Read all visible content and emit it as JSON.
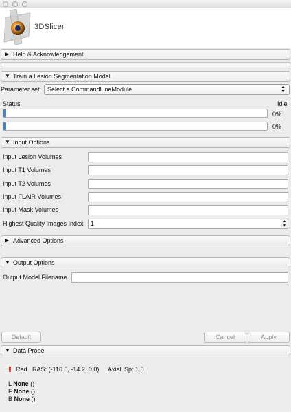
{
  "window": {
    "controls": [
      "close",
      "minimize",
      "zoom"
    ]
  },
  "app": {
    "logo_text": "3DSlicer"
  },
  "sections": {
    "help": "Help & Acknowledgement",
    "module": "Train a Lesion Segmentation Model",
    "input": "Input Options",
    "advanced": "Advanced Options",
    "output": "Output Options",
    "probe": "Data Probe"
  },
  "parameter_set": {
    "label": "Parameter set:",
    "value": "Select a CommandLineModule"
  },
  "status": {
    "label": "Status",
    "state": "Idle",
    "bars": [
      {
        "label": "0%",
        "value": 0.01
      },
      {
        "label": "0%",
        "value": 0.01
      }
    ]
  },
  "input_fields": [
    {
      "label": "Input Lesion Volumes",
      "value": ""
    },
    {
      "label": "Input T1 Volumes",
      "value": ""
    },
    {
      "label": "Input T2 Volumes",
      "value": ""
    },
    {
      "label": "Input FLAIR Volumes",
      "value": ""
    },
    {
      "label": "Input Mask Volumes",
      "value": ""
    }
  ],
  "quality_index": {
    "label": "Highest Quality Images Index",
    "value": "1"
  },
  "output": {
    "filename_label": "Output Model Filename",
    "filename_value": ""
  },
  "buttons": {
    "default": "Default",
    "cancel": "Cancel",
    "apply": "Apply"
  },
  "probe": {
    "view": "Red",
    "ras": "RAS: (-116.5, -14.2, 0.0)",
    "orientation": "Axial",
    "spacing": "Sp: 1.0",
    "layers": [
      {
        "key": "L",
        "value": "None",
        "suffix": "()"
      },
      {
        "key": "F",
        "value": "None",
        "suffix": "()"
      },
      {
        "key": "B",
        "value": "None",
        "suffix": "()"
      }
    ]
  },
  "colors": {
    "progress_fill": "#4d80c4",
    "red_view_marker": "#e3483c"
  },
  "icons": {
    "collapsed": "triangle-right-icon",
    "expanded": "triangle-down-icon",
    "logo": "slicer-logo-icon"
  }
}
